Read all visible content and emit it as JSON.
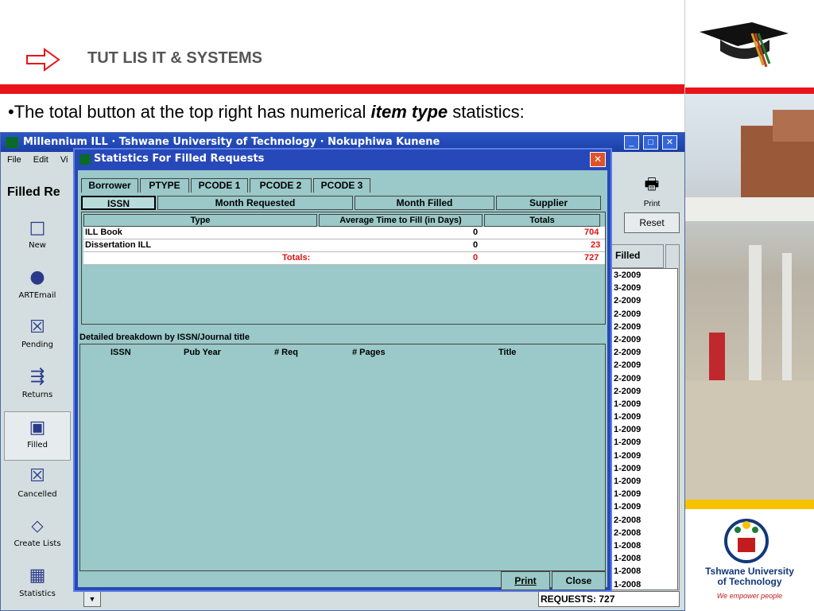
{
  "slide": {
    "title": "TUT LIS IT & SYSTEMS",
    "bullet_prefix": "•The total button at the top right has numerical ",
    "bullet_em": "item type",
    "bullet_suffix": " statistics:",
    "logo_line1": "Tshwane University",
    "logo_line2": "of Technology",
    "logo_tag": "We empower people"
  },
  "app": {
    "title": "Millennium ILL · Tshwane University of Technology · Nokuphiwa Kunene",
    "menu": [
      "File",
      "Edit",
      "Vi"
    ],
    "heading": "Filled Re",
    "print_label": "Print",
    "reset_label": "Reset",
    "filled_header": "Filled",
    "requests": "REQUESTS: 727",
    "sidebar": [
      "New",
      "ARTEmail",
      "Pending",
      "Returns",
      "Filled",
      "Cancelled",
      "Create Lists",
      "Statistics"
    ],
    "dates": [
      "3-2009",
      "3-2009",
      "2-2009",
      "2-2009",
      "2-2009",
      "2-2009",
      "2-2009",
      "2-2009",
      "2-2009",
      "2-2009",
      "1-2009",
      "1-2009",
      "1-2009",
      "1-2009",
      "1-2009",
      "1-2009",
      "1-2009",
      "1-2009",
      "1-2009",
      "2-2008",
      "2-2008",
      "1-2008",
      "1-2008",
      "1-2008",
      "1-2008"
    ]
  },
  "dialog": {
    "title": "Statistics For Filled Requests",
    "tabs": [
      "Borrower",
      "PTYPE",
      "PCODE 1",
      "PCODE 2",
      "PCODE 3"
    ],
    "subtabs": [
      "ISSN",
      "Month Requested",
      "Month Filled",
      "Supplier"
    ],
    "columns": [
      "Type",
      "Average Time to Fill (in Days)",
      "Totals"
    ],
    "rows": [
      {
        "type": "ILL Book",
        "avg": "0",
        "total": "704"
      },
      {
        "type": "Dissertation ILL",
        "avg": "0",
        "total": "23"
      }
    ],
    "totals": {
      "label": "Totals:",
      "avg": "0",
      "total": "727"
    },
    "detail_label": "Detailed breakdown by ISSN/Journal title",
    "detail_columns": [
      "ISSN",
      "Pub Year",
      "# Req",
      "# Pages",
      "Title"
    ],
    "print_button": "Print",
    "close_button": "Close"
  }
}
